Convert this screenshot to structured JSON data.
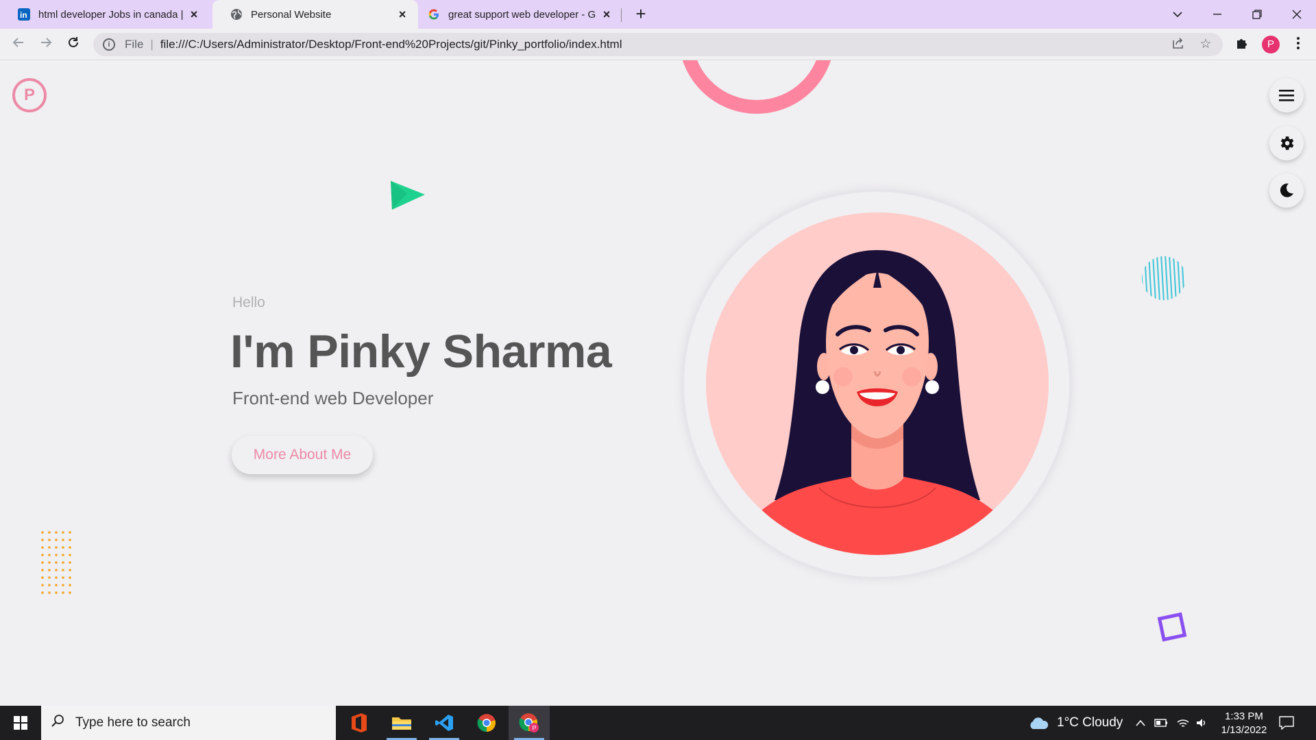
{
  "browser": {
    "tabs": [
      {
        "title": "html developer Jobs in canada | L",
        "icon": "linkedin-icon"
      },
      {
        "title": "Personal Website",
        "icon": "globe-icon"
      },
      {
        "title": "great support web developer - G",
        "icon": "google-icon"
      }
    ],
    "url_scheme": "File",
    "url": "file:///C:/Users/Administrator/Desktop/Front-end%20Projects/git/Pinky_portfolio/index.html",
    "profile_initial": "P"
  },
  "page": {
    "logo_letter": "P",
    "greeting": "Hello",
    "name": "I'm Pinky Sharma",
    "role": "Front-end web Developer",
    "cta_label": "More About Me",
    "colors": {
      "accent_pink": "#ec8aa6",
      "ring_pink": "#fd859f",
      "triangle_green": "#1fd18e",
      "lines_teal": "#3cc6d8",
      "dots_orange": "#f5a524",
      "square_purple": "#8a4ff0",
      "avatar_bg": "#ffccca"
    }
  },
  "taskbar": {
    "search_placeholder": "Type here to search",
    "weather": "1°C  Cloudy",
    "time": "1:33 PM",
    "date": "1/13/2022"
  }
}
